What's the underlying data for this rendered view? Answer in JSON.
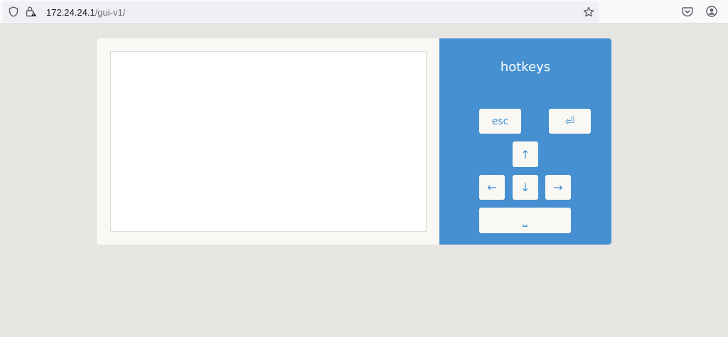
{
  "browser": {
    "url_host": "172.24.24.1",
    "url_path": "/gui-v1/",
    "icons": [
      "shield-icon",
      "lock-warning-icon",
      "star-icon",
      "pocket-icon",
      "account-icon"
    ]
  },
  "hotkeys": {
    "title": "hotkeys",
    "keys": {
      "esc": "esc",
      "enter": "⏎",
      "up": "↑",
      "left": "←",
      "down": "↓",
      "right": "→",
      "space": "⎵"
    }
  },
  "colors": {
    "page_background": "#e6e5e1",
    "panel_accent": "#4690d1",
    "card_background": "#f9f8f5",
    "screen_background": "#ffffff"
  }
}
